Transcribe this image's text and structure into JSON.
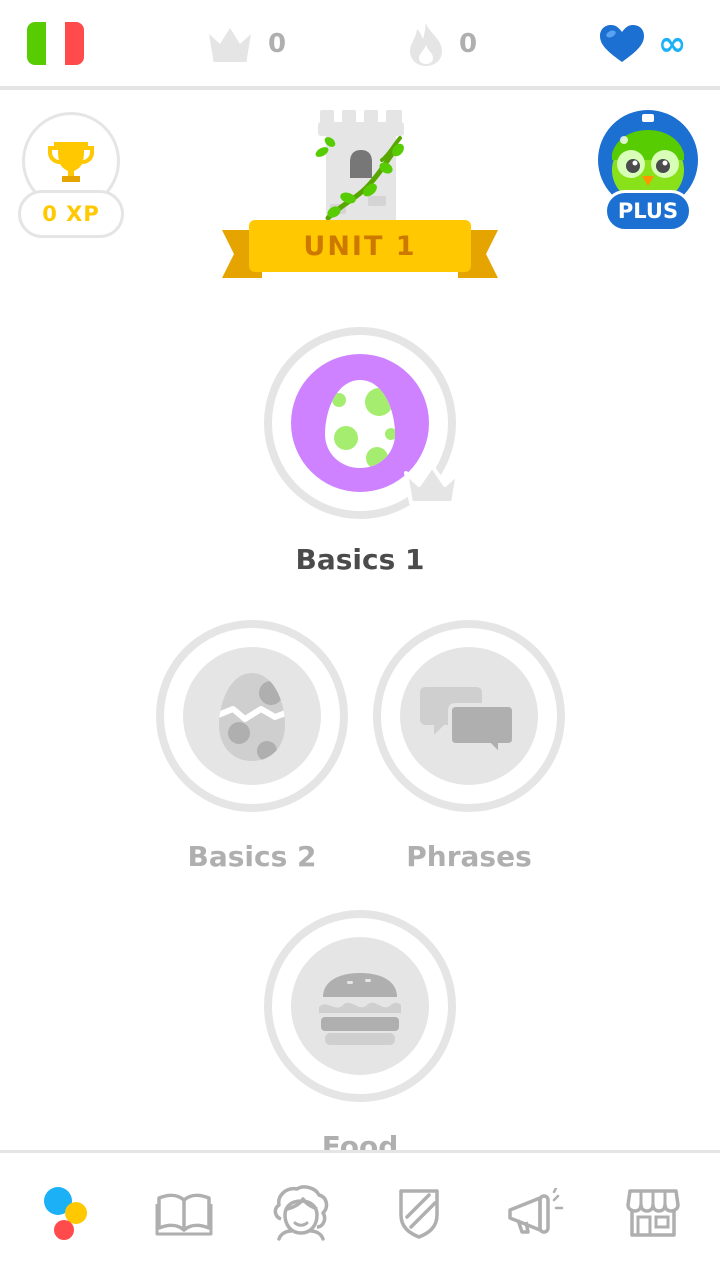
{
  "colors": {
    "brand_green": "#58cc02",
    "gold": "#ffc800",
    "gold_dark": "#cd7900",
    "heart_blue": "#1c70d1",
    "infinity_blue": "#1cb0f6",
    "disabled_gray": "#afafaf",
    "skill_purple": "#ce82ff",
    "ring_gray": "#e5e5e5"
  },
  "topbar": {
    "language_flag": "italy-flag",
    "crowns_count": "0",
    "streak_count": "0",
    "hearts_value": "∞"
  },
  "xp_badge": {
    "label": "0 XP",
    "icon": "trophy-icon"
  },
  "plus_badge": {
    "label": "PLUS",
    "icon": "owl-avatar-icon"
  },
  "unit": {
    "label": "UNIT 1",
    "icon": "castle-icon"
  },
  "skills": [
    {
      "label": "Basics 1",
      "icon": "egg-icon",
      "state": "active",
      "crown_level": "0"
    },
    {
      "label": "Basics 2",
      "icon": "cracked-egg-icon",
      "state": "locked"
    },
    {
      "label": "Phrases",
      "icon": "speech-bubbles-icon",
      "state": "locked"
    },
    {
      "label": "Food",
      "icon": "burger-icon",
      "state": "locked"
    }
  ],
  "bottom_nav": [
    {
      "name": "learn",
      "icon": "learn-dots-icon",
      "selected": true
    },
    {
      "name": "stories",
      "icon": "book-icon"
    },
    {
      "name": "profile",
      "icon": "profile-face-icon"
    },
    {
      "name": "leaderboards",
      "icon": "shield-icon"
    },
    {
      "name": "news",
      "icon": "megaphone-icon"
    },
    {
      "name": "shop",
      "icon": "shop-icon"
    }
  ]
}
